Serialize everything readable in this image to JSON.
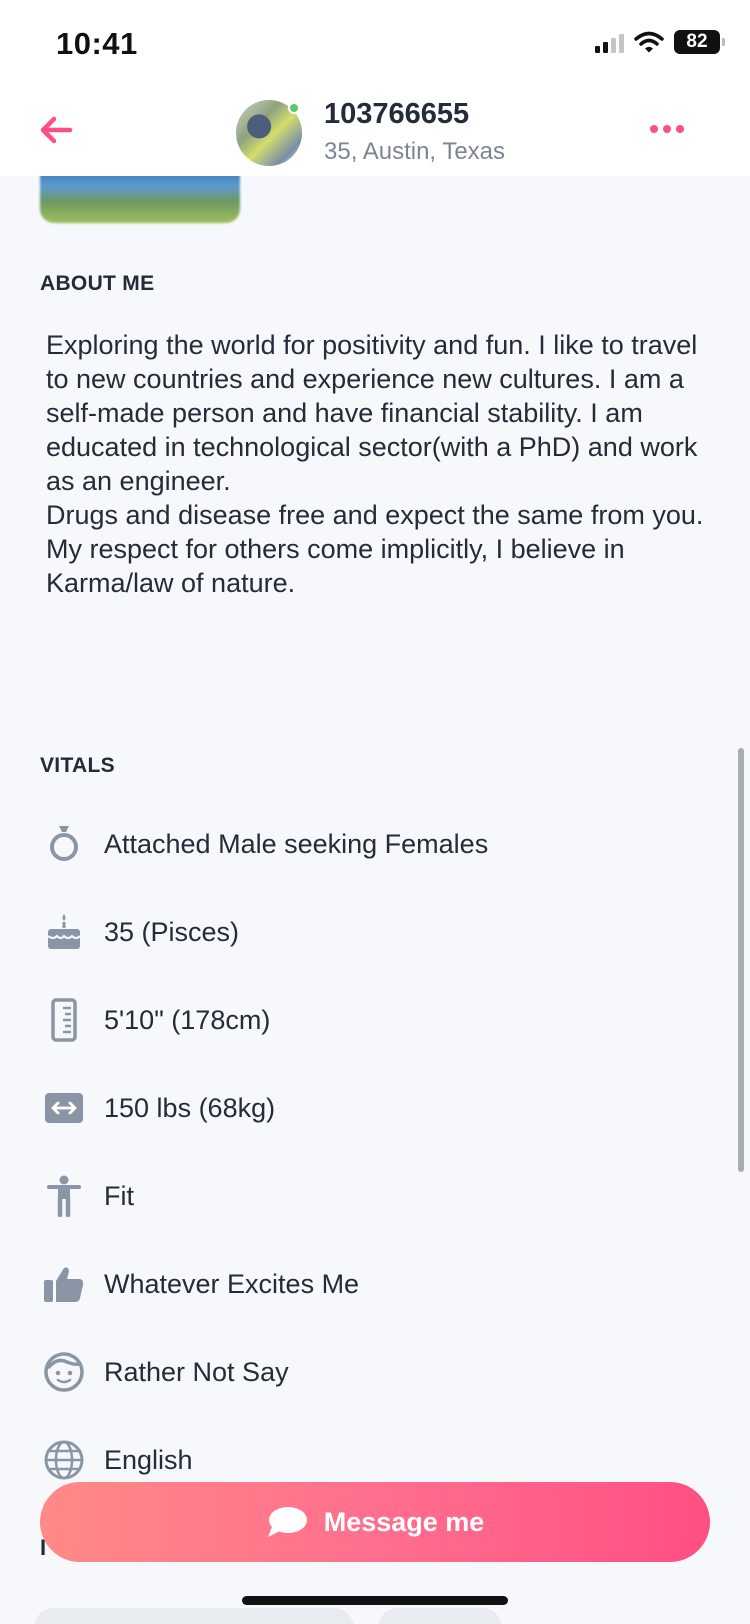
{
  "status_bar": {
    "time": "10:41",
    "battery": "82"
  },
  "header": {
    "name": "103766655",
    "location": "35, Austin, Texas"
  },
  "about": {
    "title": "ABOUT ME",
    "text": "Exploring the world for positivity and fun. I like to travel to new countries and experience new cultures. I am a self-made person and have financial stability. I am educated in technological sector(with a PhD) and work as an engineer.\nDrugs and disease free and expect the same from you.\nMy respect for others come implicitly, I believe in Karma/law of nature."
  },
  "vitals": {
    "title": "VITALS",
    "items": [
      {
        "icon": "ring-icon",
        "label": "Attached Male seeking Females"
      },
      {
        "icon": "cake-icon",
        "label": "35 (Pisces)"
      },
      {
        "icon": "ruler-icon",
        "label": "5'10\" (178cm)"
      },
      {
        "icon": "weight-icon",
        "label": "150 lbs (68kg)"
      },
      {
        "icon": "body-icon",
        "label": "Fit"
      },
      {
        "icon": "thumbs-up-icon",
        "label": "Whatever Excites Me"
      },
      {
        "icon": "face-icon",
        "label": "Rather Not Say"
      },
      {
        "icon": "globe-icon",
        "label": "English"
      }
    ]
  },
  "next_section_title_partial": "I",
  "message_button": {
    "label": "Message me"
  },
  "colors": {
    "accent": "#ff4f82",
    "accent_light": "#ff8a86",
    "icon_gray": "#8a96a6",
    "online": "#61c46a"
  }
}
